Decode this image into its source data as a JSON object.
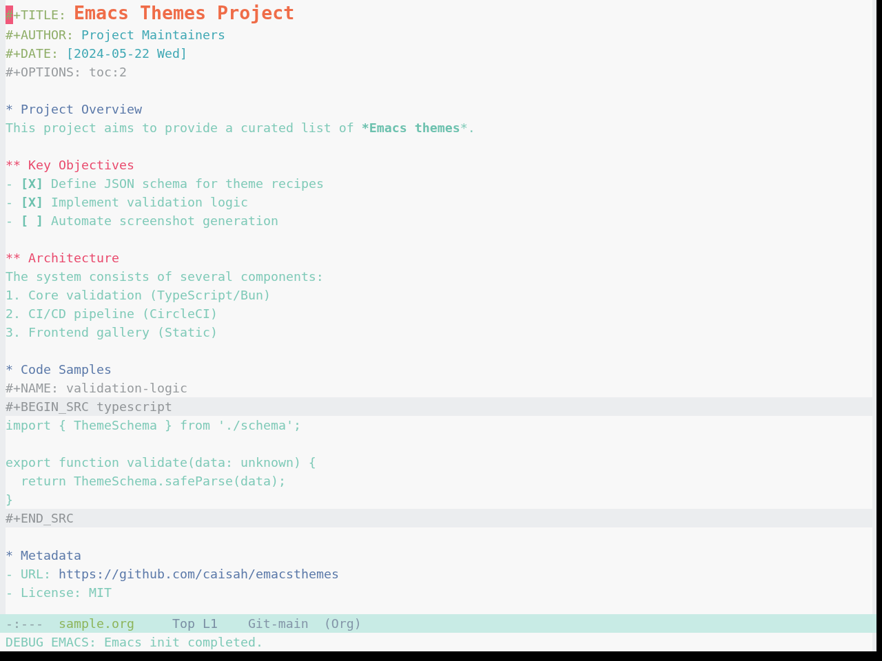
{
  "buffer": {
    "keywords": [
      {
        "kind": "title",
        "keyword": "#+TITLE:",
        "value": "Emacs Themes Project",
        "cursor": true
      },
      {
        "kind": "text",
        "keyword": "#+AUTHOR:",
        "value": "Project Maintainers",
        "cursor": false
      },
      {
        "kind": "text",
        "keyword": "#+DATE:",
        "value": "[2024-05-22 Wed]",
        "cursor": false
      },
      {
        "kind": "option",
        "keyword": "#+OPTIONS:",
        "value": "toc:2",
        "cursor": false
      }
    ],
    "sections": [
      {
        "heading": "* Project Overview",
        "body": [
          {
            "kind": "paragraph",
            "text": "This project aims to provide a curated list of ***Emacs themes***."
          }
        ],
        "children": [
          {
            "heading": "** Key Objectives",
            "body": [
              {
                "kind": "checkbox_item",
                "bullet": "-",
                "checkbox": "[X]",
                "text": "Define JSON schema for theme recipes"
              },
              {
                "kind": "checkbox_item",
                "bullet": "-",
                "checkbox": "[X]",
                "text": "Implement validation logic"
              },
              {
                "kind": "checkbox_item",
                "bullet": "-",
                "checkbox": "[ ]",
                "text": "Automate screenshot generation"
              }
            ]
          },
          {
            "heading": "** Architecture",
            "body": [
              {
                "kind": "paragraph",
                "text": "The system consists of several components:"
              },
              {
                "kind": "numbered_item",
                "number": "1.",
                "text": "Core validation (TypeScript/Bun)"
              },
              {
                "kind": "numbered_item",
                "number": "2.",
                "text": "CI/CD pipeline (CircleCI)"
              },
              {
                "kind": "numbered_item",
                "number": "3.",
                "text": "Frontend gallery (Static)"
              }
            ]
          }
        ]
      },
      {
        "heading": "* Code Samples",
        "body": [
          {
            "kind": "meta_line",
            "text": "#+NAME: validation-logic"
          },
          {
            "kind": "src_block",
            "begin": "#+BEGIN_SRC typescript",
            "code": "import { ThemeSchema } from './schema';\n\nexport function validate(data: unknown) {\n  return ThemeSchema.safeParse(data);\n}",
            "end": "#+END_SRC"
          }
        ]
      },
      {
        "heading": "* Metadata",
        "body": [
          {
            "kind": "link_item",
            "bullet": "-",
            "label": "URL:",
            "link": "https://github.com/caisah/emacsthemes"
          },
          {
            "kind": "list_item",
            "bullet": "-",
            "text": "License: MIT"
          }
        ]
      }
    ]
  },
  "mode_line": {
    "status": "-:---",
    "buffer_name": "sample.org",
    "position": "Top L1",
    "branch": "Git-main",
    "major_mode": "(Org)"
  },
  "echo_area": {
    "message": "DEBUG EMACS: Emacs init completed."
  }
}
